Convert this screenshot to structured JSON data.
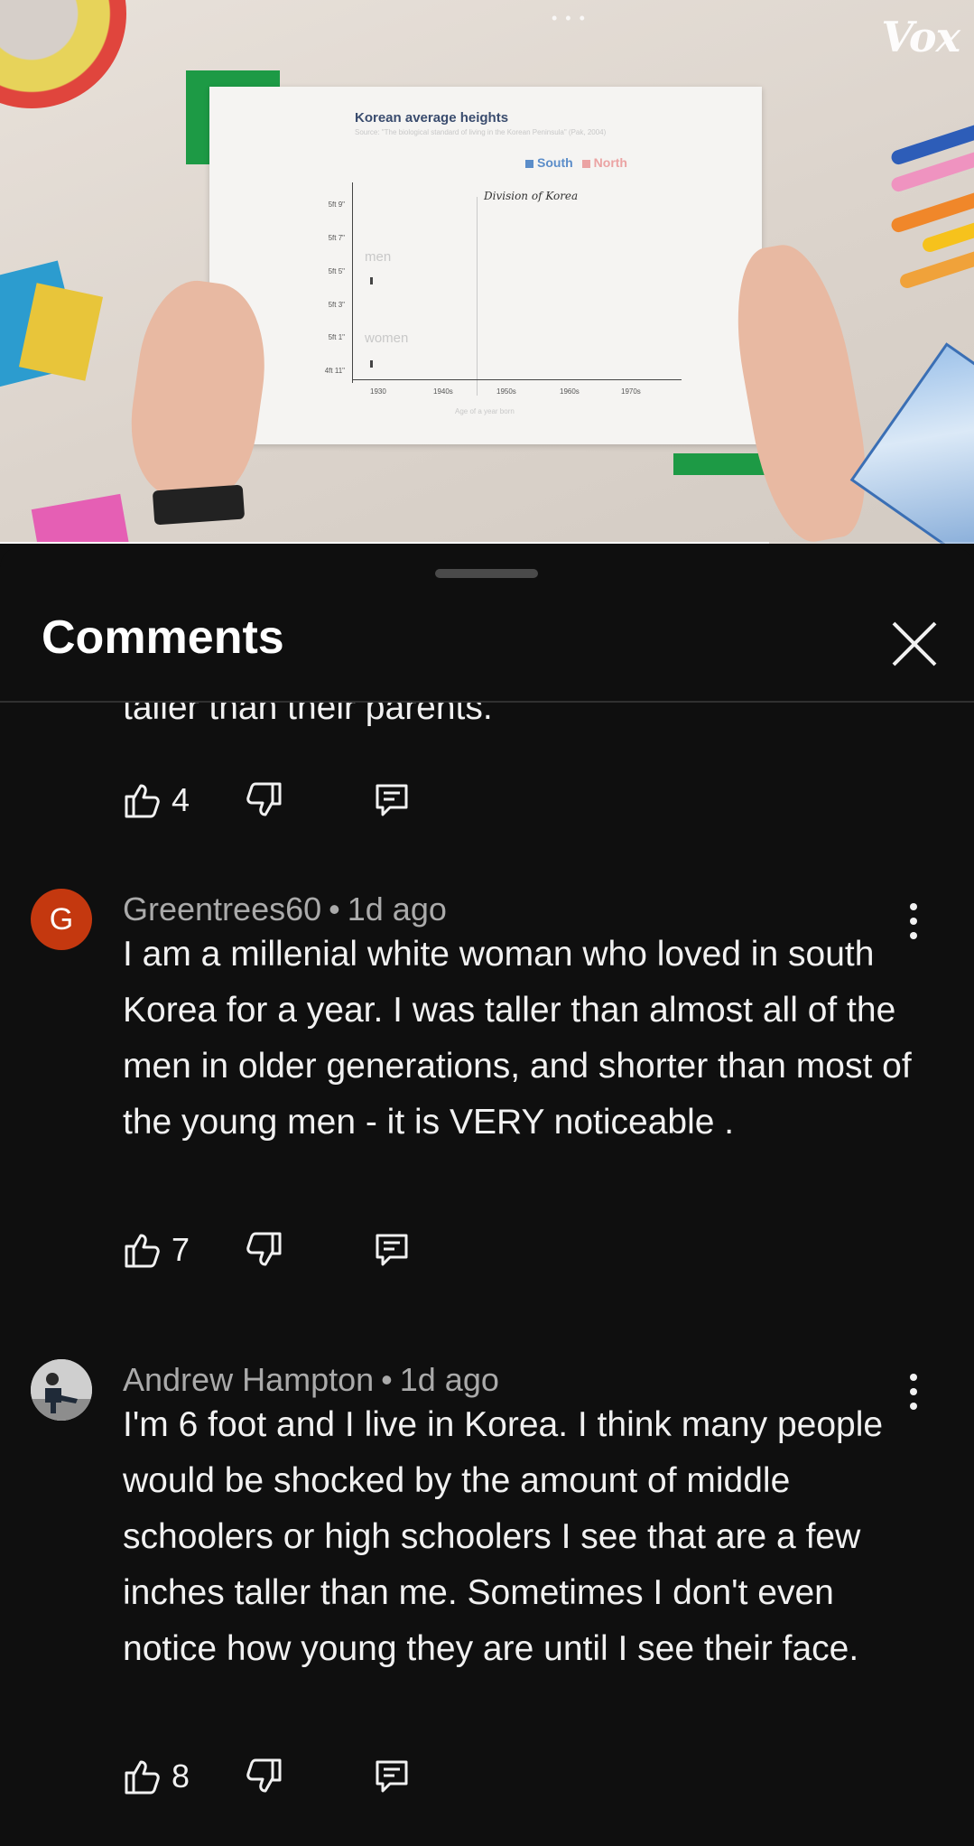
{
  "video": {
    "brand": "Vox",
    "top_indicator": "• • •",
    "progress_fraction": 0.79,
    "chart_on_screen": {
      "title": "Korean average heights",
      "source": "Source: \"The biological standard of living in the Korean Peninsula\" (Pak, 2004)",
      "legend": [
        "South",
        "North"
      ],
      "annotation": "Division of Korea",
      "y_ticks": [
        "5ft 9\"",
        "5ft 7\"",
        "5ft 5\"",
        "5ft 3\"",
        "5ft 1\"",
        "4ft 11\""
      ],
      "x_ticks": [
        "1930",
        "1940s",
        "1950s",
        "1960s",
        "1970s"
      ],
      "x_label": "Age of a year born",
      "series_labels": [
        "men",
        "women"
      ]
    }
  },
  "sheet": {
    "title": "Comments",
    "close_icon": "close-icon"
  },
  "comments": {
    "partial": {
      "text_tail": "taller than their parents.",
      "likes": "4"
    },
    "items": [
      {
        "author": "Greentrees60",
        "time": "1d ago",
        "avatar_letter": "G",
        "avatar_color": "#c4380f",
        "text": "I am a millenial white woman who loved in south Korea for a year. I was taller than almost all of the men in older generations, and shorter than most of the young men - it is VERY noticeable .",
        "likes": "7"
      },
      {
        "author": "Andrew Hampton",
        "time": "1d ago",
        "avatar_letter": "",
        "avatar_color": "#c9c9c9",
        "text": "I'm 6 foot and I live in Korea. I think many people would be shocked by the amount of middle schoolers or high schoolers I see that are a few inches taller than me. Sometimes I don't even notice how young they are until I see their face.",
        "likes": "8"
      }
    ]
  },
  "separator": "•"
}
